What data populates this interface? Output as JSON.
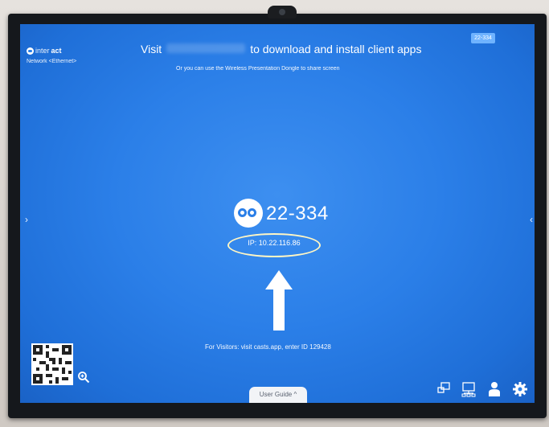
{
  "room_badge": "22-334",
  "brand": {
    "prefix": "inter",
    "bold": "act"
  },
  "network": "Network <Ethernet>",
  "visit": {
    "before": "Visit",
    "after": "to download and install client apps"
  },
  "dongle_note": "Or you can use the Wireless Presentation Dongle to share screen",
  "room_name": "22-334",
  "ip_label": "IP: 10.22.116.86",
  "visitors_note": "For Visitors: visit casts.app, enter ID 129428",
  "user_guide": "User Guide ^",
  "icons": [
    "chevron-left-icon",
    "chevron-right-icon",
    "qr-code",
    "zoom-in-icon",
    "screen-share-icon",
    "network-devices-icon",
    "user-icon",
    "gear-icon"
  ],
  "colors": {
    "screen_bg": "#2b7fe8",
    "highlight_oval": "#fff6c4",
    "badge": "#6fb3ff",
    "guide_tab": "#f2f4f7"
  }
}
